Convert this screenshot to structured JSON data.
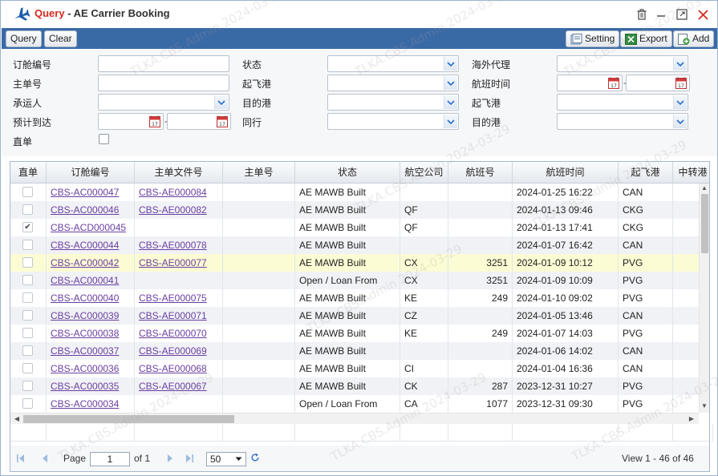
{
  "window": {
    "title_prefix": "Query",
    "title_separator": " - ",
    "title_main": "AE Carrier Booking"
  },
  "toolbar": {
    "query_label": "Query",
    "clear_label": "Clear",
    "setting_label": "Setting",
    "export_label": "Export",
    "add_label": "Add"
  },
  "form": {
    "booking_no_label": "订舱编号",
    "mawb_label": "主单号",
    "carrier_label": "承运人",
    "eta_label": "预计到达",
    "direct_label": "直单",
    "status_label": "状态",
    "origin_label": "起飞港",
    "destination_label": "目的港",
    "peer_label": "同行",
    "agent_label": "海外代理",
    "flight_time_label": "航班时间",
    "origin2_label": "起飞港",
    "destination2_label": "目的港",
    "date_separator": "-"
  },
  "grid": {
    "columns": [
      "直单",
      "订舱编号",
      "主单文件号",
      "主单号",
      "状态",
      "航空公司",
      "航班号",
      "航班时间",
      "起飞港",
      "中转港"
    ],
    "rows": [
      {
        "direct": false,
        "booking": "CBS-AC000047",
        "mawb_file": "CBS-AE000084",
        "mawb": "",
        "status": "AE MAWB Built",
        "airline": "",
        "flight": "",
        "time": "2024-01-25 16:22",
        "origin": "CAN",
        "transit": ""
      },
      {
        "direct": false,
        "booking": "CBS-AC000046",
        "mawb_file": "CBS-AE000082",
        "mawb": "",
        "status": "AE MAWB Built",
        "airline": "QF",
        "flight": "",
        "time": "2024-01-13 09:46",
        "origin": "CKG",
        "transit": ""
      },
      {
        "direct": true,
        "booking": "CBS-ACD000045",
        "mawb_file": "",
        "mawb": "",
        "status": "AE MAWB Built",
        "airline": "QF",
        "flight": "",
        "time": "2024-01-13 17:41",
        "origin": "CKG",
        "transit": ""
      },
      {
        "direct": false,
        "booking": "CBS-AC000044",
        "mawb_file": "CBS-AE000078",
        "mawb": "",
        "status": "AE MAWB Built",
        "airline": "",
        "flight": "",
        "time": "2024-01-07 16:42",
        "origin": "CAN",
        "transit": ""
      },
      {
        "direct": false,
        "booking": "CBS-AC000042",
        "mawb_file": "CBS-AE000077",
        "mawb": "",
        "status": "AE MAWB Built",
        "airline": "CX",
        "flight": "3251",
        "time": "2024-01-09 10:12",
        "origin": "PVG",
        "transit": ""
      },
      {
        "direct": false,
        "booking": "CBS-AC000041",
        "mawb_file": "",
        "mawb": "",
        "status": "Open / Loan From",
        "airline": "CX",
        "flight": "3251",
        "time": "2024-01-09 10:09",
        "origin": "PVG",
        "transit": ""
      },
      {
        "direct": false,
        "booking": "CBS-AC000040",
        "mawb_file": "CBS-AE000075",
        "mawb": "",
        "status": "AE MAWB Built",
        "airline": "KE",
        "flight": "249",
        "time": "2024-01-10 09:02",
        "origin": "PVG",
        "transit": ""
      },
      {
        "direct": false,
        "booking": "CBS-AC000039",
        "mawb_file": "CBS-AE000071",
        "mawb": "",
        "status": "AE MAWB Built",
        "airline": "CZ",
        "flight": "",
        "time": "2024-01-05 13:46",
        "origin": "CAN",
        "transit": ""
      },
      {
        "direct": false,
        "booking": "CBS-AC000038",
        "mawb_file": "CBS-AE000070",
        "mawb": "",
        "status": "AE MAWB Built",
        "airline": "KE",
        "flight": "249",
        "time": "2024-01-07 14:03",
        "origin": "PVG",
        "transit": ""
      },
      {
        "direct": false,
        "booking": "CBS-AC000037",
        "mawb_file": "CBS-AE000069",
        "mawb": "",
        "status": "AE MAWB Built",
        "airline": "",
        "flight": "",
        "time": "2024-01-06 14:02",
        "origin": "CAN",
        "transit": ""
      },
      {
        "direct": false,
        "booking": "CBS-AC000036",
        "mawb_file": "CBS-AE000068",
        "mawb": "",
        "status": "AE MAWB Built",
        "airline": "CI",
        "flight": "",
        "time": "2024-01-04 16:36",
        "origin": "CAN",
        "transit": ""
      },
      {
        "direct": false,
        "booking": "CBS-AC000035",
        "mawb_file": "CBS-AE000067",
        "mawb": "",
        "status": "AE MAWB Built",
        "airline": "CK",
        "flight": "287",
        "time": "2023-12-31 10:27",
        "origin": "PVG",
        "transit": ""
      },
      {
        "direct": false,
        "booking": "CBS-AC000034",
        "mawb_file": "",
        "mawb": "",
        "status": "Open / Loan From",
        "airline": "CA",
        "flight": "1077",
        "time": "2023-12-31 09:30",
        "origin": "PVG",
        "transit": ""
      }
    ]
  },
  "pager": {
    "page_label": "Page",
    "page_value": "1",
    "of_label": "of 1",
    "page_size": "50",
    "view_text": "View 1 - 46 of 46"
  },
  "watermark": "TLKA.CBS.Admin 2024-03-29",
  "colors": {
    "toolbar_bg": "#3a6aa6",
    "title_accent": "#d42b1e",
    "link": "#6b3fa0",
    "highlight_row": "#fcfcd4"
  }
}
